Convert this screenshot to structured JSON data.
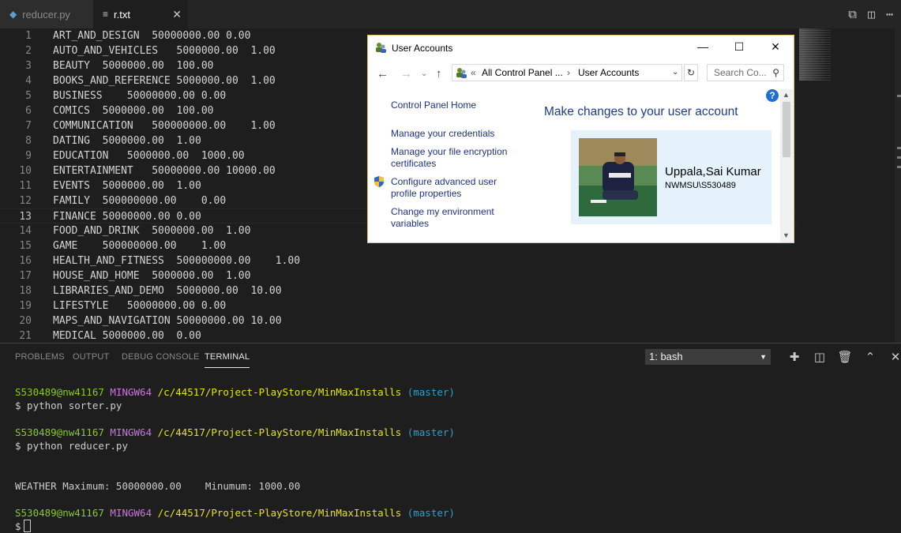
{
  "tabs": [
    {
      "label": "reducer.py",
      "icon": "python-file-icon"
    },
    {
      "label": "r.txt",
      "icon": "text-file-icon"
    }
  ],
  "editor": {
    "current_line": 13,
    "lines": [
      {
        "n": "1",
        "text": "ART_AND_DESIGN  50000000.00 0.00"
      },
      {
        "n": "2",
        "text": "AUTO_AND_VEHICLES   5000000.00  1.00"
      },
      {
        "n": "3",
        "text": "BEAUTY  5000000.00  100.00"
      },
      {
        "n": "4",
        "text": "BOOKS_AND_REFERENCE 5000000.00  1.00"
      },
      {
        "n": "5",
        "text": "BUSINESS    50000000.00 0.00"
      },
      {
        "n": "6",
        "text": "COMICS  5000000.00  100.00"
      },
      {
        "n": "7",
        "text": "COMMUNICATION   500000000.00    1.00"
      },
      {
        "n": "8",
        "text": "DATING  5000000.00  1.00"
      },
      {
        "n": "9",
        "text": "EDUCATION   5000000.00  1000.00"
      },
      {
        "n": "10",
        "text": "ENTERTAINMENT   50000000.00 10000.00"
      },
      {
        "n": "11",
        "text": "EVENTS  5000000.00  1.00"
      },
      {
        "n": "12",
        "text": "FAMILY  500000000.00    0.00"
      },
      {
        "n": "13",
        "text": "FINANCE 50000000.00 0.00"
      },
      {
        "n": "14",
        "text": "FOOD_AND_DRINK  5000000.00  1.00"
      },
      {
        "n": "15",
        "text": "GAME    500000000.00    1.00"
      },
      {
        "n": "16",
        "text": "HEALTH_AND_FITNESS  500000000.00    1.00"
      },
      {
        "n": "17",
        "text": "HOUSE_AND_HOME  5000000.00  1.00"
      },
      {
        "n": "18",
        "text": "LIBRARIES_AND_DEMO  5000000.00  10.00"
      },
      {
        "n": "19",
        "text": "LIFESTYLE   50000000.00 0.00"
      },
      {
        "n": "20",
        "text": "MAPS_AND_NAVIGATION 50000000.00 10.00"
      },
      {
        "n": "21",
        "text": "MEDICAL 5000000.00  0.00"
      }
    ]
  },
  "panel": {
    "tabs": [
      "PROBLEMS",
      "OUTPUT",
      "DEBUG CONSOLE",
      "TERMINAL"
    ],
    "active_tab": "TERMINAL",
    "terminal_select": "1: bash"
  },
  "terminal": {
    "prompt": {
      "user": "S530489@nw41167",
      "shell": "MINGW64",
      "path": "/c/44517/Project-PlayStore/MinMaxInstalls",
      "branch": "(master)"
    },
    "cmd1": "$ python sorter.py",
    "cmd2": "$ python reducer.py",
    "output": "WEATHER Maximum: 50000000.00    Minumum: 1000.00",
    "cmd3": "$"
  },
  "dialog": {
    "title": "User Accounts",
    "breadcrumb": [
      "«",
      "All Control Panel ...",
      "›",
      "User Accounts"
    ],
    "search_placeholder": "Search Co...",
    "links": {
      "home": "Control Panel Home",
      "credentials": "Manage your credentials",
      "encryption_1": "Manage your file encryption",
      "encryption_2": "certificates",
      "profile_1": "Configure advanced user",
      "profile_2": "profile properties",
      "env_1": "Change my environment",
      "env_2": "variables"
    },
    "heading": "Make changes to your user account",
    "user_name": "Uppala,Sai Kumar",
    "user_account": "NWMSU\\S530489"
  },
  "colors": {
    "editor_bg": "#1e1e1e",
    "prompt_user": "#8ac926",
    "prompt_shell": "#c678dd",
    "prompt_path": "#e5e510",
    "prompt_branch": "#2aa1d3",
    "dialog_link": "#1e3287",
    "dialog_heading": "#1e3c8c"
  }
}
